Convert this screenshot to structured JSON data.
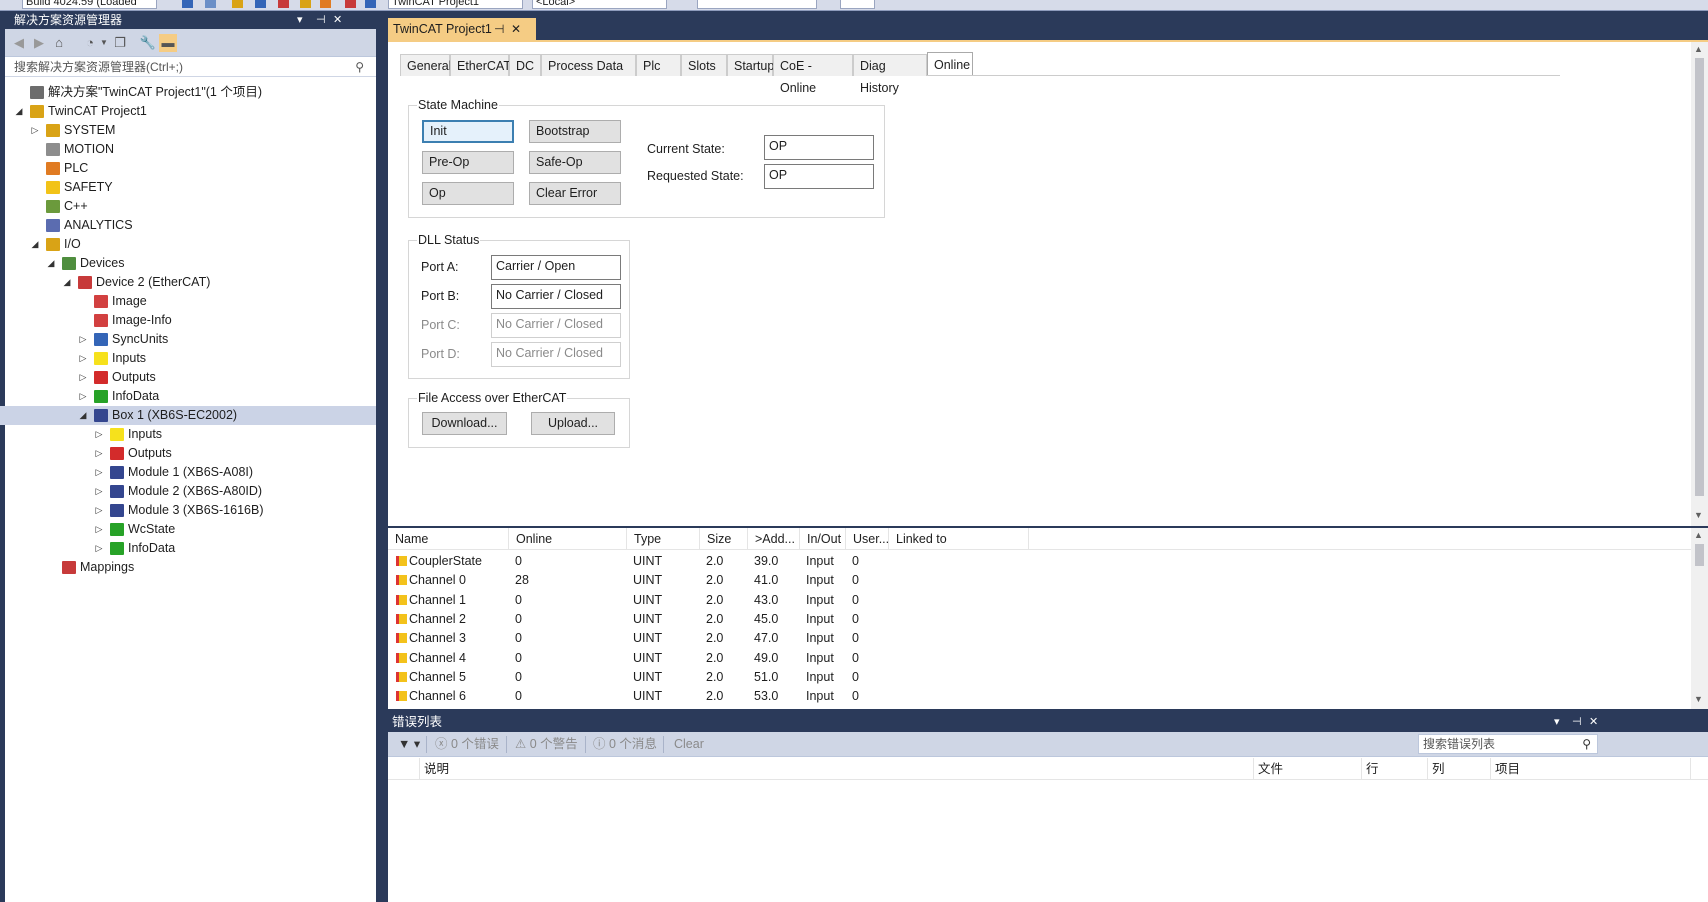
{
  "toolbar": {
    "build_combo": "Build 4024.59 (Loaded",
    "project_combo": "TwinCAT Project1",
    "target_combo": "<Local>"
  },
  "solution_explorer": {
    "title": "解决方案资源管理器",
    "search_placeholder": "搜索解决方案资源管理器(Ctrl+;)",
    "tree": [
      {
        "label": "解决方案\"TwinCAT Project1\"(1 个项目)",
        "depth": 0,
        "arrow": "",
        "icon": "solution-icon",
        "color": "#6d6d6d"
      },
      {
        "label": "TwinCAT Project1",
        "depth": 0,
        "arrow": "◢",
        "icon": "project-icon",
        "color": "#d9a316"
      },
      {
        "label": "SYSTEM",
        "depth": 1,
        "arrow": "▷",
        "icon": "system-icon",
        "color": "#d9a316"
      },
      {
        "label": "MOTION",
        "depth": 1,
        "arrow": "",
        "icon": "motion-icon",
        "color": "#8d8d8d"
      },
      {
        "label": "PLC",
        "depth": 1,
        "arrow": "",
        "icon": "plc-icon",
        "color": "#e07b22"
      },
      {
        "label": "SAFETY",
        "depth": 1,
        "arrow": "",
        "icon": "safety-icon",
        "color": "#f2c318"
      },
      {
        "label": "C++",
        "depth": 1,
        "arrow": "",
        "icon": "cpp-icon",
        "color": "#6b9a3c"
      },
      {
        "label": "ANALYTICS",
        "depth": 1,
        "arrow": "",
        "icon": "analytics-icon",
        "color": "#5b6cb0"
      },
      {
        "label": "I/O",
        "depth": 1,
        "arrow": "◢",
        "icon": "io-icon",
        "color": "#d9a316"
      },
      {
        "label": "Devices",
        "depth": 2,
        "arrow": "◢",
        "icon": "devices-icon",
        "color": "#4f8e3e"
      },
      {
        "label": "Device 2 (EtherCAT)",
        "depth": 3,
        "arrow": "◢",
        "icon": "ethercat-device-icon",
        "color": "#c73a3a"
      },
      {
        "label": "Image",
        "depth": 4,
        "arrow": "",
        "icon": "image-icon",
        "color": "#d24040"
      },
      {
        "label": "Image-Info",
        "depth": 4,
        "arrow": "",
        "icon": "image-info-icon",
        "color": "#d24040"
      },
      {
        "label": "SyncUnits",
        "depth": 4,
        "arrow": "▷",
        "icon": "syncunits-icon",
        "color": "#3465b7"
      },
      {
        "label": "Inputs",
        "depth": 4,
        "arrow": "▷",
        "icon": "inputs-icon",
        "color": "#f6e11c"
      },
      {
        "label": "Outputs",
        "depth": 4,
        "arrow": "▷",
        "icon": "outputs-icon",
        "color": "#d32b2b"
      },
      {
        "label": "InfoData",
        "depth": 4,
        "arrow": "▷",
        "icon": "infodata-icon",
        "color": "#27a227"
      },
      {
        "label": "Box 1 (XB6S-EC2002)",
        "depth": 4,
        "arrow": "◢",
        "icon": "box-icon",
        "color": "#34468f",
        "selected": true
      },
      {
        "label": "Inputs",
        "depth": 5,
        "arrow": "▷",
        "icon": "inputs-icon",
        "color": "#f6e11c"
      },
      {
        "label": "Outputs",
        "depth": 5,
        "arrow": "▷",
        "icon": "outputs-icon",
        "color": "#d32b2b"
      },
      {
        "label": "Module 1 (XB6S-A08I)",
        "depth": 5,
        "arrow": "▷",
        "icon": "module-icon",
        "color": "#34468f"
      },
      {
        "label": "Module 2 (XB6S-A80ID)",
        "depth": 5,
        "arrow": "▷",
        "icon": "module-icon",
        "color": "#34468f"
      },
      {
        "label": "Module 3 (XB6S-1616B)",
        "depth": 5,
        "arrow": "▷",
        "icon": "module-icon",
        "color": "#34468f"
      },
      {
        "label": "WcState",
        "depth": 5,
        "arrow": "▷",
        "icon": "wcstate-icon",
        "color": "#27a227"
      },
      {
        "label": "InfoData",
        "depth": 5,
        "arrow": "▷",
        "icon": "infodata-icon",
        "color": "#27a227"
      },
      {
        "label": "Mappings",
        "depth": 2,
        "arrow": "",
        "icon": "mappings-icon",
        "color": "#c73a3a"
      }
    ]
  },
  "document": {
    "tab_title": "TwinCAT Project1",
    "tabs": [
      "General",
      "EtherCAT",
      "DC",
      "Process Data",
      "Plc",
      "Slots",
      "Startup",
      "CoE - Online",
      "Diag History",
      "Online"
    ],
    "active_tab": "Online",
    "state_machine": {
      "title": "State Machine",
      "buttons": [
        "Init",
        "Bootstrap",
        "Pre-Op",
        "Safe-Op",
        "Op",
        "Clear Error"
      ],
      "current_state_label": "Current State:",
      "current_state": "OP",
      "requested_state_label": "Requested State:",
      "requested_state": "OP"
    },
    "dll_status": {
      "title": "DLL Status",
      "ports": [
        {
          "label": "Port A:",
          "value": "Carrier / Open",
          "enabled": true
        },
        {
          "label": "Port B:",
          "value": "No Carrier / Closed",
          "enabled": true
        },
        {
          "label": "Port C:",
          "value": "No Carrier / Closed",
          "enabled": false
        },
        {
          "label": "Port D:",
          "value": "No Carrier / Closed",
          "enabled": false
        }
      ]
    },
    "file_access": {
      "title": "File Access over EtherCAT",
      "download": "Download...",
      "upload": "Upload..."
    }
  },
  "variables": {
    "columns": [
      "Name",
      "Online",
      "Type",
      "Size",
      ">Add...",
      "In/Out",
      "User...",
      "Linked to"
    ],
    "rows": [
      [
        "CouplerState",
        "0",
        "UINT",
        "2.0",
        "39.0",
        "Input",
        "0",
        ""
      ],
      [
        "Channel 0",
        "28",
        "UINT",
        "2.0",
        "41.0",
        "Input",
        "0",
        ""
      ],
      [
        "Channel 1",
        "0",
        "UINT",
        "2.0",
        "43.0",
        "Input",
        "0",
        ""
      ],
      [
        "Channel 2",
        "0",
        "UINT",
        "2.0",
        "45.0",
        "Input",
        "0",
        ""
      ],
      [
        "Channel 3",
        "0",
        "UINT",
        "2.0",
        "47.0",
        "Input",
        "0",
        ""
      ],
      [
        "Channel 4",
        "0",
        "UINT",
        "2.0",
        "49.0",
        "Input",
        "0",
        ""
      ],
      [
        "Channel 5",
        "0",
        "UINT",
        "2.0",
        "51.0",
        "Input",
        "0",
        ""
      ],
      [
        "Channel 6",
        "0",
        "UINT",
        "2.0",
        "53.0",
        "Input",
        "0",
        ""
      ]
    ]
  },
  "error_list": {
    "title": "错误列表",
    "errors": "0 个错误",
    "warnings": "0 个警告",
    "messages": "0 个消息",
    "clear": "Clear",
    "search_placeholder": "搜索错误列表",
    "columns": [
      "说明",
      "文件",
      "行",
      "列",
      "项目"
    ]
  }
}
